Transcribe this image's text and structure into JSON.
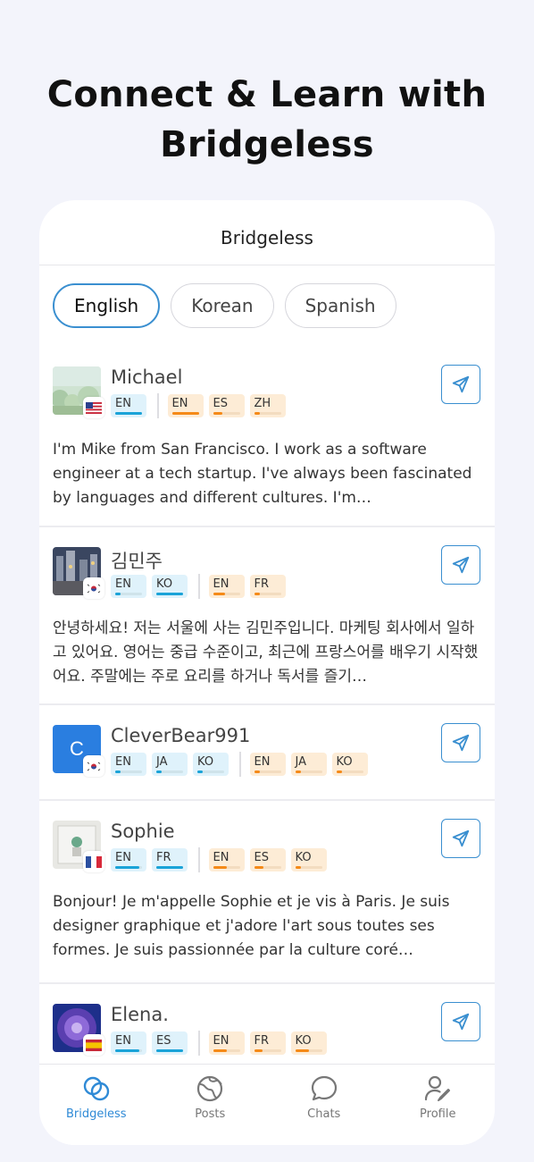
{
  "hero": {
    "line1": "Connect & Learn with",
    "line2": "Bridgeless"
  },
  "app": {
    "title": "Bridgeless"
  },
  "tabs": [
    {
      "label": "English",
      "active": true
    },
    {
      "label": "Korean",
      "active": false
    },
    {
      "label": "Spanish",
      "active": false
    }
  ],
  "users": [
    {
      "name": "Michael",
      "flag": "us-flag-icon",
      "native": [
        {
          "code": "EN",
          "level": 1.0
        }
      ],
      "learning": [
        {
          "code": "EN",
          "level": 1.0
        },
        {
          "code": "ES",
          "level": 0.35
        },
        {
          "code": "ZH",
          "level": 0.2
        }
      ],
      "bio": "I'm Mike from San Francisco. I work as a software engineer at a tech startup. I've always been fascinated by languages and different cultures. I'm…"
    },
    {
      "name": "김민주",
      "flag": "kr-flag-icon",
      "native": [
        {
          "code": "EN",
          "level": 0.2
        },
        {
          "code": "KO",
          "level": 1.0
        }
      ],
      "learning": [
        {
          "code": "EN",
          "level": 0.45
        },
        {
          "code": "FR",
          "level": 0.2
        }
      ],
      "bio": "안녕하세요! 저는 서울에 사는 김민주입니다. 마케팅 회사에서 일하고 있어요. 영어는 중급 수준이고, 최근에 프랑스어를 배우기 시작했어요. 주말에는 주로 요리를 하거나 독서를 즐기…"
    },
    {
      "name": "CleverBear991",
      "initial": "C",
      "flag": "kr-flag-icon",
      "native": [
        {
          "code": "EN",
          "level": 0.2
        },
        {
          "code": "JA",
          "level": 0.2
        },
        {
          "code": "KO",
          "level": 0.2
        }
      ],
      "learning": [
        {
          "code": "EN",
          "level": 0.2
        },
        {
          "code": "JA",
          "level": 0.2
        },
        {
          "code": "KO",
          "level": 0.2
        }
      ],
      "bio": ""
    },
    {
      "name": "Sophie",
      "flag": "fr-flag-icon",
      "native": [
        {
          "code": "EN",
          "level": 0.9
        },
        {
          "code": "FR",
          "level": 1.0
        }
      ],
      "learning": [
        {
          "code": "EN",
          "level": 0.5
        },
        {
          "code": "ES",
          "level": 0.35
        },
        {
          "code": "KO",
          "level": 0.2
        }
      ],
      "bio": "Bonjour! Je m'appelle Sophie et je vis à Paris. Je suis designer graphique et j'adore l'art sous toutes ses formes. Je suis passionnée par la culture coré…"
    },
    {
      "name": "Elena.",
      "flag": "es-flag-icon",
      "native": [
        {
          "code": "EN",
          "level": 0.9
        },
        {
          "code": "ES",
          "level": 1.0
        }
      ],
      "learning": [
        {
          "code": "EN",
          "level": 0.5
        },
        {
          "code": "FR",
          "level": 0.3
        },
        {
          "code": "KO",
          "level": 0.5
        }
      ],
      "bio": ""
    }
  ],
  "tabbar": [
    {
      "label": "Bridgeless",
      "icon": "bridgeless-rings-icon",
      "active": true
    },
    {
      "label": "Posts",
      "icon": "globe-icon",
      "active": false
    },
    {
      "label": "Chats",
      "icon": "chat-bubble-icon",
      "active": false
    },
    {
      "label": "Profile",
      "icon": "profile-edit-icon",
      "active": false
    }
  ],
  "colors": {
    "accent": "#2f8ad6",
    "native_bar": "#1aa3d8",
    "learn_bar": "#f58a18"
  }
}
